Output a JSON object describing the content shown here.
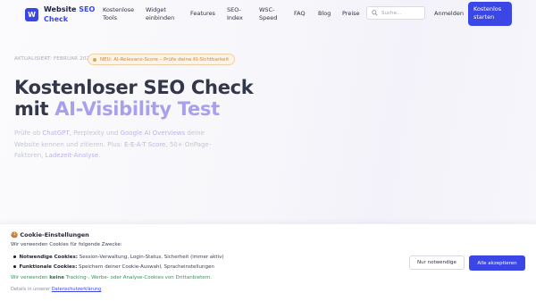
{
  "brand": {
    "logo_letter": "W",
    "name_part1": "Website",
    "name_part2": "SEO",
    "name_part3": "Check",
    "accent_color": "#3b46e6"
  },
  "nav": {
    "items": [
      {
        "line1": "Kostenlose",
        "line2": "Tools"
      },
      {
        "line1": "Widget",
        "line2": "einbinden"
      },
      {
        "line1": "Features",
        "line2": ""
      },
      {
        "line1": "SEO-",
        "line2": "Index"
      },
      {
        "line1": "WSC-",
        "line2": "Speed"
      },
      {
        "line1": "FAQ",
        "line2": ""
      },
      {
        "line1": "Blog",
        "line2": ""
      },
      {
        "line1": "Preise",
        "line2": ""
      }
    ],
    "search_placeholder": "Suche...",
    "login": "Anmelden",
    "cta_line1": "Kostenlos",
    "cta_line2": "starten"
  },
  "hero": {
    "updated": "AKTUALISIERT: FEBRUAR 2026",
    "pill": "NEU: AI-Relevanz-Score – Prüfe deine KI-Sichtbarkeit",
    "title_line1": "Kostenloser SEO Check",
    "title_line2_prefix": "mit ",
    "title_line2_accent": "AI-Visibility Test",
    "desc": {
      "t1": "Prüfe ob ",
      "h1": "ChatGPT",
      "t2": ", Perplexity und ",
      "h2": "Google AI Overviews",
      "t3": " deine Website kennen und zitieren. Plus: ",
      "h3": "E-E-A-T Score",
      "t4": ", 50+ OnPage-Faktoren, ",
      "h4": "Ladezeit-Analyse",
      "t5": "."
    }
  },
  "cookie": {
    "title": "🍪 Cookie-Einstellungen",
    "intro": "Wir verwenden Cookies für folgende Zwecke:",
    "items": [
      {
        "label": "Notwendige Cookies:",
        "text": " Session-Verwaltung, Login-Status, Sicherheit (immer aktiv)"
      },
      {
        "label": "Funktionale Cookies:",
        "text": " Speichern deiner Cookie-Auswahl, Spracheinstellungen"
      }
    ],
    "note_prefix": "Wir verwenden ",
    "note_bold": "keine",
    "note_suffix": " Tracking-, Werbe- oder Analyse-Cookies von Drittanbietern.",
    "privacy_prefix": "Details in unserer ",
    "privacy_link": "Datenschutzerklärung",
    "btn_necessary": "Nur notwendige",
    "btn_accept": "Alle akzeptieren"
  }
}
